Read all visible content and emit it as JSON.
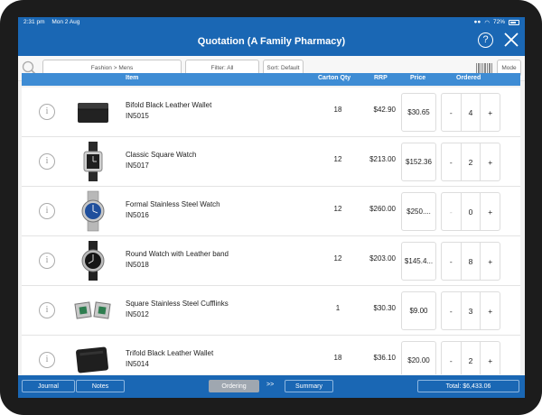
{
  "status": {
    "time": "2:31 pm",
    "date": "Mon 2 Aug",
    "battery": "72%",
    "battery_level": 0.72
  },
  "header": {
    "title": "Quotation  (A Family Pharmacy)",
    "help": "?"
  },
  "filters": {
    "category": "Fashion > Mens",
    "filter": "Filter: All",
    "sort": "Sort: Default",
    "mode": "Mode"
  },
  "columns": {
    "item": "Item",
    "carton": "Carton Qty",
    "rrp": "RRP",
    "price": "Price",
    "ordered": "Ordered"
  },
  "icons": {
    "info": "i"
  },
  "stepper": {
    "minus": "-",
    "plus": "+"
  },
  "products": [
    {
      "name": "Bifold Black Leather Wallet",
      "code": "IN5015",
      "carton": "18",
      "rrp": "$42.90",
      "price": "$30.65",
      "ordered": "4",
      "thumb": "wallet-icon"
    },
    {
      "name": "Classic Square Watch",
      "code": "IN5017",
      "carton": "12",
      "rrp": "$213.00",
      "price": "$152.36",
      "ordered": "2",
      "thumb": "square-watch-icon"
    },
    {
      "name": "Formal Stainless Steel Watch",
      "code": "IN5016",
      "carton": "12",
      "rrp": "$260.00",
      "price": "$250....",
      "ordered": "0",
      "thumb": "steel-watch-icon"
    },
    {
      "name": "Round Watch with Leather band",
      "code": "IN5018",
      "carton": "12",
      "rrp": "$203.00",
      "price": "$145.4...",
      "ordered": "8",
      "thumb": "round-watch-icon"
    },
    {
      "name": "Square Stainless Steel Cufflinks",
      "code": "IN5012",
      "carton": "1",
      "rrp": "$30.30",
      "price": "$9.00",
      "ordered": "3",
      "thumb": "cufflinks-icon"
    },
    {
      "name": "Trifold Black Leather Wallet",
      "code": "IN5014",
      "carton": "18",
      "rrp": "$36.10",
      "price": "$20.00",
      "ordered": "2",
      "thumb": "wallet-icon"
    }
  ],
  "footer": {
    "journal": "Journal",
    "notes": "Notes",
    "ordering": "Ordering",
    "arrows": ">>",
    "summary": "Summary",
    "total": "Total: $6,433.06"
  },
  "colors": {
    "brand": "#1a67b4",
    "table_header": "#3e8cd4"
  }
}
